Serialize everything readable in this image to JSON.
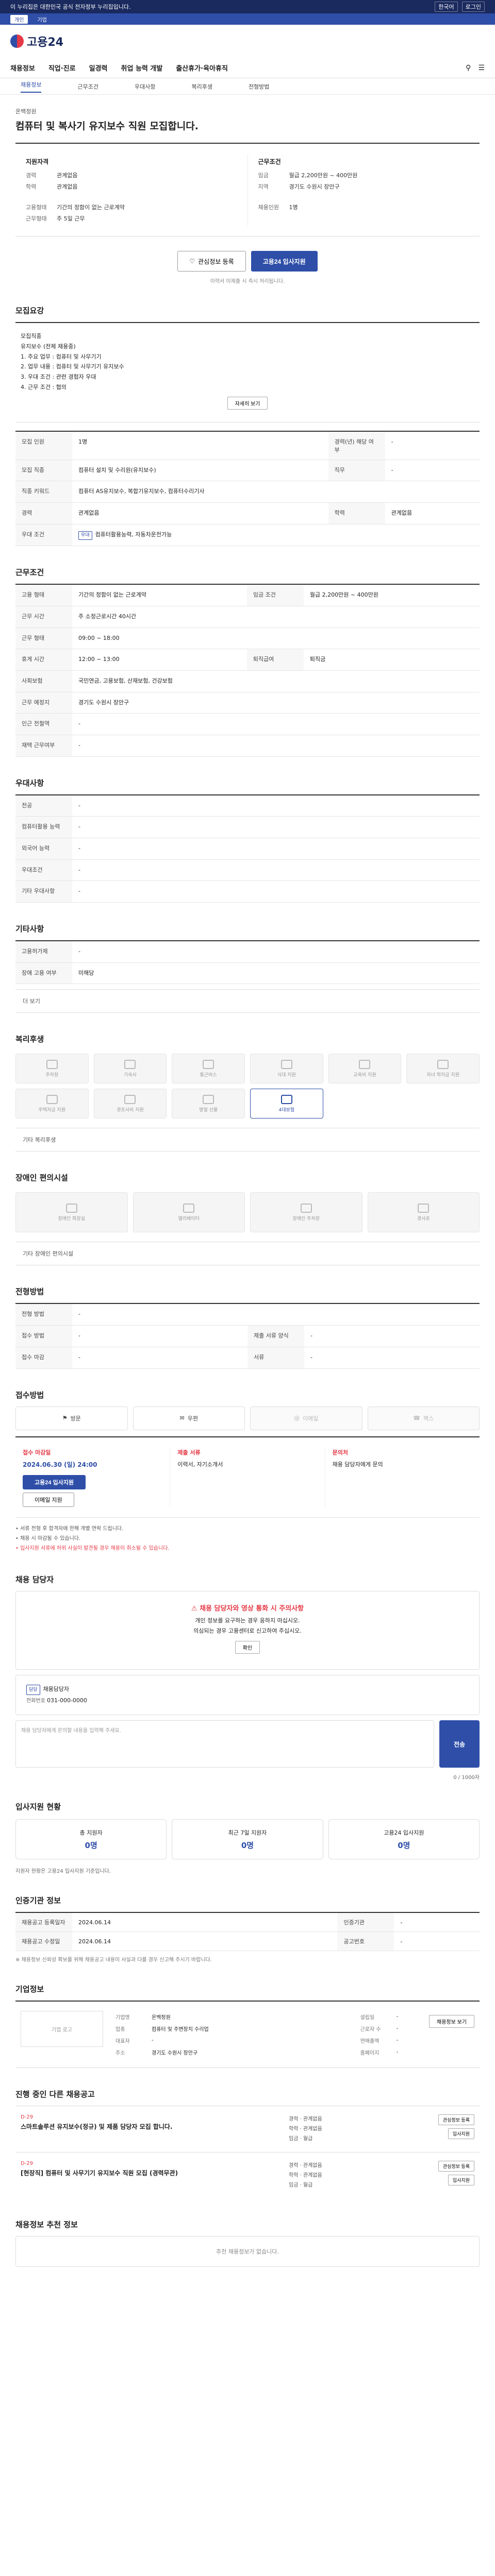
{
  "topbar": {
    "left": "이 누리집은 대한민국 공식 전자정부 누리집입니다.",
    "lang": "한국어",
    "login": "로그인"
  },
  "bar2": {
    "items": [
      "개인",
      "기업"
    ]
  },
  "site": {
    "name": "고용24"
  },
  "gnb": {
    "items": [
      "채용정보",
      "직업·진로",
      "일경력",
      "취업 능력 개발",
      "출산휴가·육아휴직"
    ]
  },
  "lnb": {
    "items": [
      "채용정보",
      "근무조건",
      "우대사항",
      "복리후생",
      "전형방법"
    ]
  },
  "job": {
    "company": "온백정원",
    "title": "컴퓨터 및 복사기 유지보수 직원 모집합니다.",
    "summary_left_title": "지원자격",
    "summary_right_title": "근무조건",
    "left_rows": [
      {
        "k": "경력",
        "v": "관계없음"
      },
      {
        "k": "학력",
        "v": "관계없음"
      }
    ],
    "right_rows": [
      {
        "k": "임금",
        "v": "월급 2,200만원 ~ 400만원"
      },
      {
        "k": "지역",
        "v": "경기도 수원시 장안구"
      }
    ],
    "left_rows2": [
      {
        "k": "고용형태",
        "v": "기간의 정함이 없는 근로계약"
      },
      {
        "k": "근무형태",
        "v": "주 5일 근무"
      }
    ],
    "right_rows2": [
      {
        "k": "채용인원",
        "v": "1명"
      }
    ]
  },
  "buttons": {
    "scrap": "관심정보 등록",
    "apply": "고용24 입사지원"
  },
  "note": "이력서 미제출 시 즉시 처리됩니다.",
  "sec": {
    "recruit": "모집요강",
    "work": "근무조건",
    "pref": "우대사항",
    "etc": "기타사항",
    "welfare": "복리후생",
    "disable": "장애인 편의시설",
    "method": "전형방법",
    "process": "접수방법",
    "contact": "채용 담당자",
    "stats": "입사지원 현황",
    "info": "인증기관 정보",
    "company": "기업정보",
    "others": "진행 중인 다른 채용공고",
    "similar": "채용정보 추천 정보"
  },
  "recruit_box": [
    "모집직종",
    "유지보수 (전체 채용중)",
    "1. 주요 업무 : 컴퓨터 및 사무기기",
    "2. 업무 내용 : 컴퓨터 및 사무기기 유지보수",
    "3. 우대 조건 : 관련 경험자 우대",
    "4. 근무 조건 : 협의"
  ],
  "recruit_more": "자세히 보기",
  "recruit_table": [
    {
      "k": "모집 인원",
      "v": "1명",
      "k2": "경력(년) 해당 여부",
      "v2": "-"
    },
    {
      "k": "모집 직종",
      "v": "컴퓨터 설치 및 수리원(유지보수)",
      "k2": "직무",
      "v2": "-"
    },
    {
      "k": "직종 키워드",
      "v": "컴퓨터 AS유지보수, 복합기유지보수, 컴퓨터수리기사",
      "k2": "",
      "v2": ""
    },
    {
      "k": "경력",
      "v": "관계없음",
      "k2": "학력",
      "v2": "관계없음"
    },
    {
      "k": "우대 조건",
      "v": "컴퓨터활용능력, 자동차운전가능",
      "k2": "",
      "v2": ""
    }
  ],
  "work_table": [
    {
      "k": "고용 형태",
      "v": "기간의 정함이 없는 근로계약",
      "k2": "임금 조건",
      "v2": "월급 2,200만원 ~ 400만원"
    },
    {
      "k": "근무 시간",
      "v": "주 소정근로시간 40시간",
      "k2": "",
      "v2": ""
    },
    {
      "k": "근무 형태",
      "v": "09:00 ~ 18:00",
      "k2": "",
      "v2": ""
    },
    {
      "k": "휴게 시간",
      "v": "12:00 ~ 13:00",
      "k2": "퇴직급여",
      "v2": "퇴직금"
    },
    {
      "k": "사회보험",
      "v": "국민연금, 고용보험, 산재보험, 건강보험",
      "k2": "",
      "v2": ""
    },
    {
      "k": "근무 예정지",
      "v": "경기도 수원시 장안구",
      "k2": "",
      "v2": ""
    },
    {
      "k": "인근 전철역",
      "v": "-",
      "k2": "",
      "v2": ""
    },
    {
      "k": "재택 근무여부",
      "v": "-",
      "k2": "",
      "v2": ""
    }
  ],
  "pref_table": [
    {
      "k": "전공",
      "v": "-"
    },
    {
      "k": "컴퓨터활용 능력",
      "v": "-"
    },
    {
      "k": "외국어 능력",
      "v": "-"
    },
    {
      "k": "우대조건",
      "v": "-"
    },
    {
      "k": "기타 우대사항",
      "v": "-"
    }
  ],
  "etc_table": [
    {
      "k": "고용허가제",
      "v": "-"
    },
    {
      "k": "장애 고용 여부",
      "v": "미해당"
    }
  ],
  "etc_more": "더 보기",
  "welfare_icons": [
    "주차장",
    "기숙사",
    "통근버스",
    "식대 지원",
    "교육비 지원",
    "자녀 학자금 지원",
    "주택자금 지원",
    "경조사비 지원",
    "명절 선물",
    "4대보험"
  ],
  "welfare_extra": "기타 복리후생",
  "disable_icons": [
    "장애인 화장실",
    "엘리베이터",
    "장애인 주차장",
    "경사로"
  ],
  "disable_extra": "기타 장애인 편의시설",
  "method_table": [
    {
      "k": "전형 방법",
      "v": "-",
      "k2": "",
      "v2": ""
    },
    {
      "k": "접수 방법",
      "v": "-",
      "k2": "제출 서류 양식",
      "v2": "-"
    },
    {
      "k": "접수 마감",
      "v": "-",
      "k2": "서류",
      "v2": "-"
    }
  ],
  "method_buttons": [
    "방문",
    "우편",
    "이메일",
    "팩스"
  ],
  "process": {
    "col1_lab": "접수 마감일",
    "col1_v": "2024.06.30 (일) 24:00",
    "col1_btn": "고용24 입사지원",
    "col1_btn2": "이메일 지원",
    "col2_lab": "제출 서류",
    "col2_v": "이력서, 자기소개서",
    "col3_lab": "문의처",
    "col3_v": "채용 담당자에게 문의"
  },
  "process_bullets": [
    "서류 전형 후 합격자에 한해 개별 연락 드립니다.",
    "채용 시 마감될 수 있습니다.",
    "입사지원 서류에 허위 사실이 발견될 경우 채용이 취소될 수 있습니다."
  ],
  "contact": {
    "alert_head": "채용 담당자와 영상 통화 시 주의사항",
    "alert_lines": [
      "개인 정보를 요구하는 경우 응하지 마십시오.",
      "의심되는 경우 고용센터로 신고하여 주십시오."
    ],
    "alert_btn": "확인",
    "name": "채용담당자",
    "tel": "031-000-0000",
    "inq_placeholder": "채용 담당자에게 문의할 내용을 입력해 주세요.",
    "inq_count": "0 / 1000자",
    "send": "전송"
  },
  "stats": [
    {
      "k": "총 지원자",
      "v": "0명"
    },
    {
      "k": "최근 7일 지원자",
      "v": "0명"
    },
    {
      "k": "고용24 입사지원",
      "v": "0명"
    }
  ],
  "stats_note": "지원자 현황은 고용24 입사지원 기준입니다.",
  "info_table": [
    {
      "k": "채용공고 등록일자",
      "v": "2024.06.14",
      "k2": "인증기관",
      "v2": "-"
    },
    {
      "k": "채용공고 수정일",
      "v": "2024.06.14",
      "k2": "공고번호",
      "v2": "-"
    }
  ],
  "info_note": "※ 채용정보 신뢰성 확보를 위해 채용공고 내용이 사실과 다를 경우 신고해 주시기 바랍니다.",
  "company": {
    "logo": "기업 로고",
    "rows": [
      {
        "k": "기업명",
        "v": "온백정원",
        "k2": "설립일",
        "v2": "-"
      },
      {
        "k": "업종",
        "v": "컴퓨터 및 주변장치 수리업",
        "k2": "근로자 수",
        "v2": "-"
      },
      {
        "k": "대표자",
        "v": "-",
        "k2": "연매출액",
        "v2": "-"
      },
      {
        "k": "주소",
        "v": "경기도 수원시 장안구",
        "k2": "홈페이지",
        "v2": "-"
      }
    ],
    "btn": "채용정보 보기"
  },
  "others": [
    {
      "d": "D-29",
      "t": "스마트솔루션 유지보수(정규) 및 제품 담당자 모집 합니다.",
      "m1": "경력 · 관계없음",
      "m2": "학력 · 관계없음",
      "m3": "임금 · 월급",
      "btn1": "관심정보 등록",
      "btn2": "입사지원"
    },
    {
      "d": "D-29",
      "t": "[현장직] 컴퓨터 및 사무기기 유지보수 직원 모집 (경력무관)",
      "m1": "경력 · 관계없음",
      "m2": "학력 · 관계없음",
      "m3": "임금 · 월급",
      "btn1": "관심정보 등록",
      "btn2": "입사지원"
    }
  ],
  "similar_empty": "추천 채용정보가 없습니다."
}
